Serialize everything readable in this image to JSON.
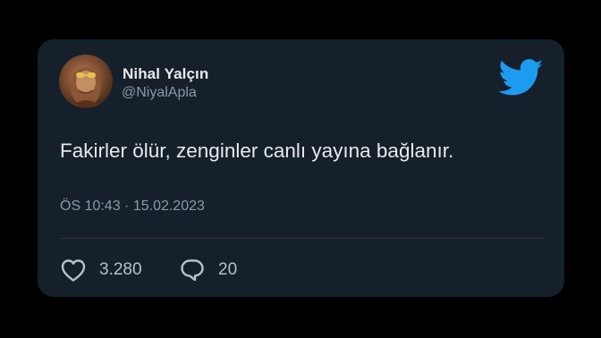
{
  "author": {
    "name": "Nihal Yalçın",
    "handle": "@NiyalApla"
  },
  "tweet": {
    "text": "Fakirler ölür, zenginler canlı yayına bağlanır.",
    "timestamp": "ÖS 10:43 · 15.02.2023"
  },
  "stats": {
    "likes": "3.280",
    "replies": "20"
  },
  "icons": {
    "brand": "twitter-bird-icon",
    "like": "heart-icon",
    "reply": "comment-bubble-icon"
  },
  "colors": {
    "background": "#000000",
    "card": "#15202b",
    "primary_text": "#e7e9ea",
    "secondary_text": "#8b98a5",
    "brand_blue": "#1d9bf0"
  }
}
